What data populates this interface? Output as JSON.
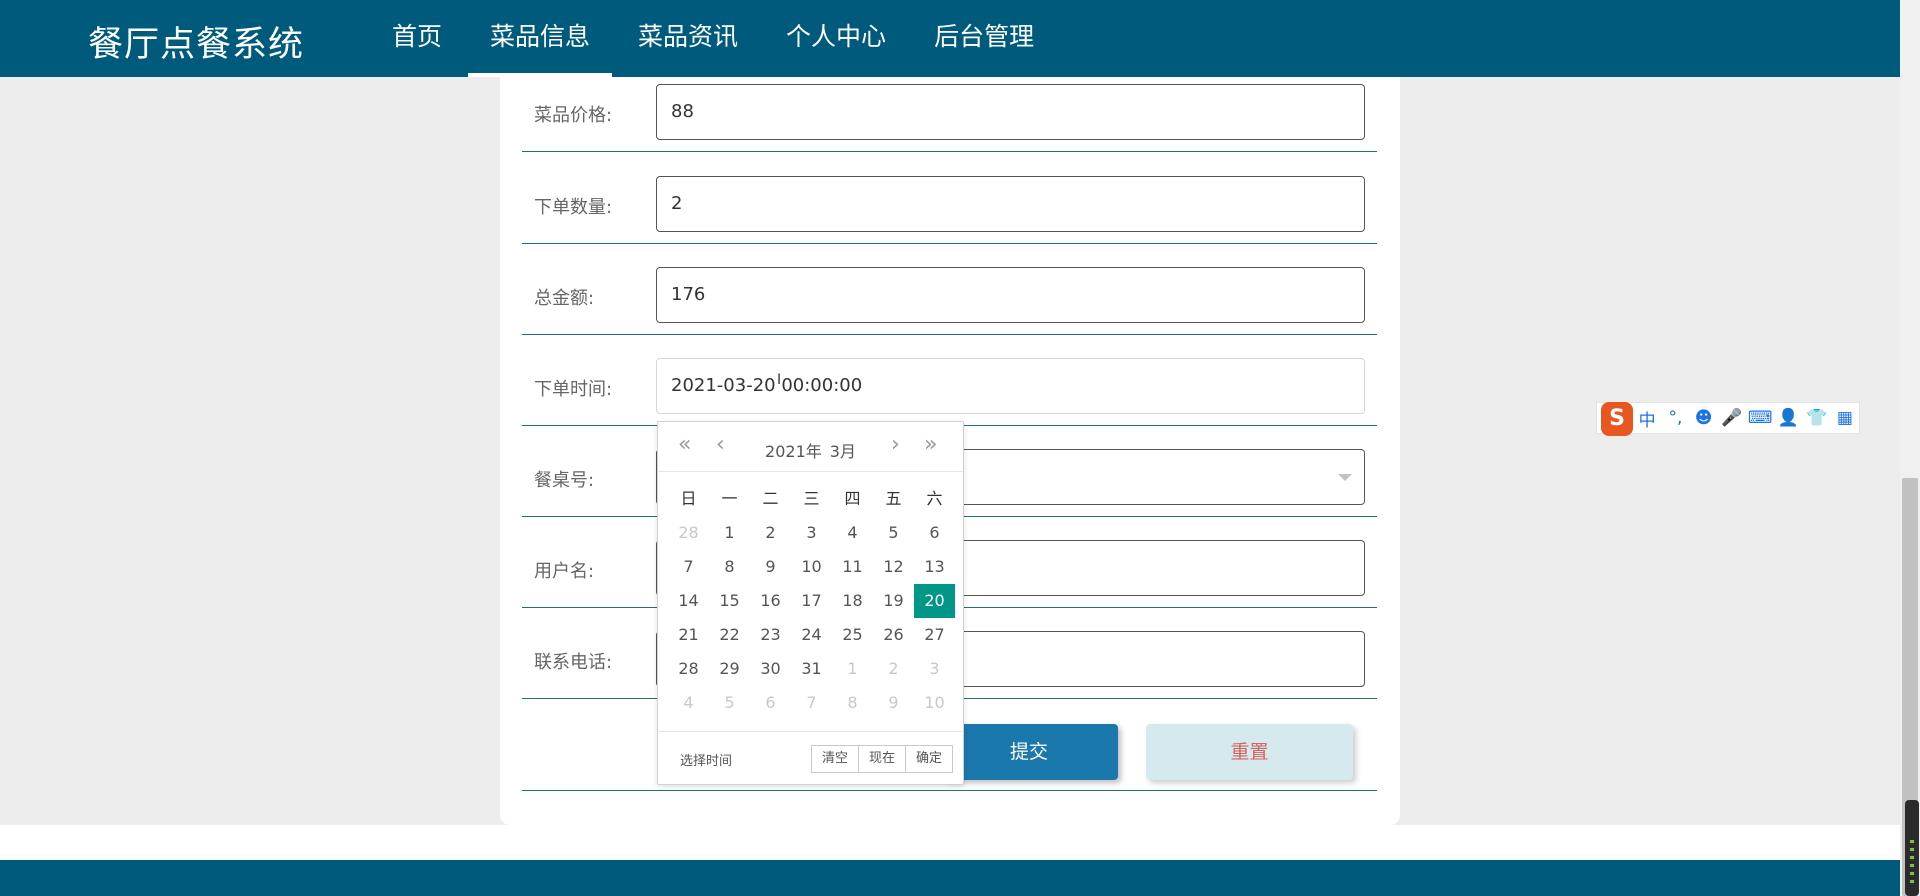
{
  "header": {
    "logo": "餐厅点餐系统",
    "nav": [
      {
        "label": "首页",
        "active": false
      },
      {
        "label": "菜品信息",
        "active": true
      },
      {
        "label": "菜品资讯",
        "active": false
      },
      {
        "label": "个人中心",
        "active": false
      },
      {
        "label": "后台管理",
        "active": false
      }
    ]
  },
  "form": {
    "price": {
      "label": "菜品价格:",
      "value": "88"
    },
    "quantity": {
      "label": "下单数量:",
      "value": "2"
    },
    "total": {
      "label": "总金额:",
      "value": "176"
    },
    "order_time": {
      "label": "下单时间:",
      "value": "2021-03-20 00:00:00"
    },
    "table_no": {
      "label": "餐桌号:",
      "value": ""
    },
    "username": {
      "label": "用户名:",
      "value": ""
    },
    "phone": {
      "label": "联系电话:",
      "value": ""
    },
    "submit_label": "提交",
    "reset_label": "重置"
  },
  "datepicker": {
    "year": "2021年",
    "month": "3月",
    "weekdays": [
      "日",
      "一",
      "二",
      "三",
      "四",
      "五",
      "六"
    ],
    "weeks": [
      [
        {
          "d": "28",
          "m": 1
        },
        {
          "d": "1"
        },
        {
          "d": "2"
        },
        {
          "d": "3"
        },
        {
          "d": "4"
        },
        {
          "d": "5"
        },
        {
          "d": "6"
        }
      ],
      [
        {
          "d": "7"
        },
        {
          "d": "8"
        },
        {
          "d": "9"
        },
        {
          "d": "10"
        },
        {
          "d": "11"
        },
        {
          "d": "12"
        },
        {
          "d": "13"
        }
      ],
      [
        {
          "d": "14"
        },
        {
          "d": "15"
        },
        {
          "d": "16"
        },
        {
          "d": "17"
        },
        {
          "d": "18"
        },
        {
          "d": "19"
        },
        {
          "d": "20",
          "s": 1
        }
      ],
      [
        {
          "d": "21"
        },
        {
          "d": "22"
        },
        {
          "d": "23"
        },
        {
          "d": "24"
        },
        {
          "d": "25"
        },
        {
          "d": "26"
        },
        {
          "d": "27"
        }
      ],
      [
        {
          "d": "28"
        },
        {
          "d": "29"
        },
        {
          "d": "30"
        },
        {
          "d": "31"
        },
        {
          "d": "1",
          "m": 1
        },
        {
          "d": "2",
          "m": 1
        },
        {
          "d": "3",
          "m": 1
        }
      ],
      [
        {
          "d": "4",
          "m": 1
        },
        {
          "d": "5",
          "m": 1
        },
        {
          "d": "6",
          "m": 1
        },
        {
          "d": "7",
          "m": 1
        },
        {
          "d": "8",
          "m": 1
        },
        {
          "d": "9",
          "m": 1
        },
        {
          "d": "10",
          "m": 1
        }
      ]
    ],
    "select_time_label": "选择时间",
    "clear_label": "清空",
    "now_label": "现在",
    "confirm_label": "确定",
    "selected_color": "#009688"
  },
  "ime": {
    "logo": "S",
    "items": [
      "中",
      "°,",
      "☻",
      "🎤",
      "⌨",
      "👤",
      "👕",
      "▦"
    ]
  },
  "colors": {
    "brand": "#005a7c",
    "submit": "#1b78ad",
    "reset_bg": "#d6e9ef",
    "reset_text": "#d8605e"
  }
}
